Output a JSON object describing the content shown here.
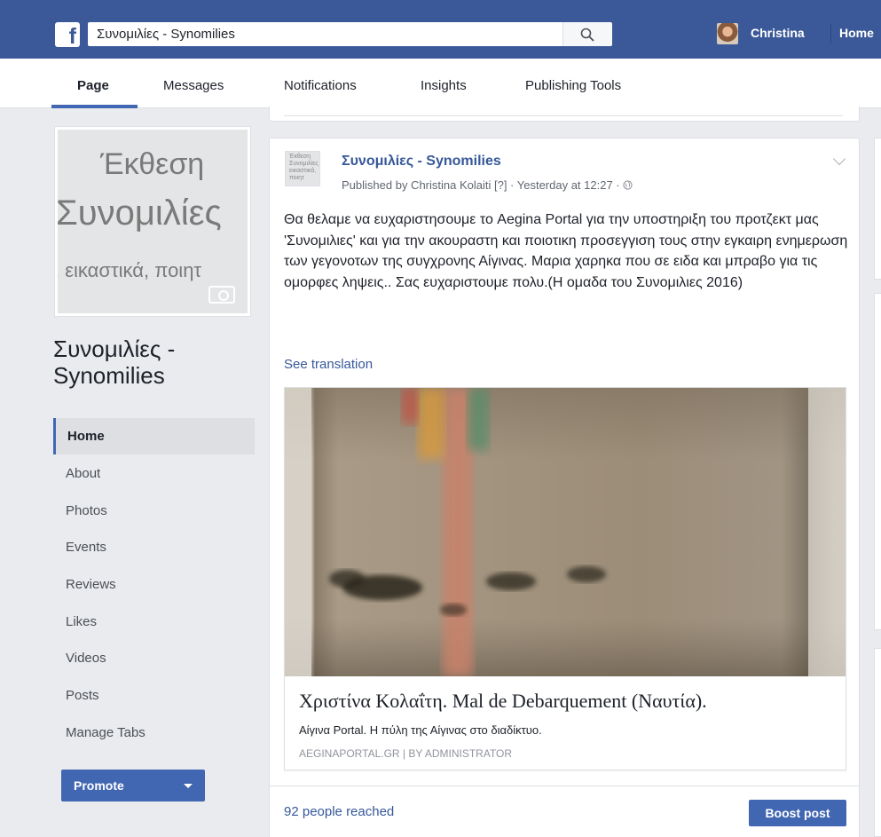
{
  "topbar": {
    "logo_letter": "f",
    "search_value": "Συνομιλίες - Synomilies",
    "user_name": "Christina",
    "home_label": "Home"
  },
  "page_tabs": [
    "Page",
    "Messages",
    "Notifications",
    "Insights",
    "Publishing Tools"
  ],
  "sidebar": {
    "cover_lines": [
      "Έκθεση",
      "Συνομιλίες",
      ", εικαστικά, ποιητ"
    ],
    "page_name": "Συνομιλίες - Synomilies",
    "nav": [
      "Home",
      "About",
      "Photos",
      "Events",
      "Reviews",
      "Likes",
      "Videos",
      "Posts",
      "Manage Tabs"
    ],
    "promote_label": "Promote"
  },
  "post": {
    "thumb_text": "Έκθεση Συνομιλίες εικαστικά, ποιητ",
    "author": "Συνομιλίες - Synomilies",
    "meta": "Published by Christina Kolaiti [?] · Yesterday at 12:27 ·",
    "text": "Θα θελαμε να ευχαριστησουμε το Aegina Portal για την υποστηριξη του προτζεκτ μας 'Συνομιλιες' και για την ακουραστη και ποιοτικη προσεγγιση τους στην εγκαιρη ενημερωση των γεγονοτων της συγχρονης Αίγινας. Μαρια χαρηκα που σε ειδα και μπραβο για τις ομορφες ληψεις.. Σας ευχαριστουμε πολυ.(Η ομαδα του Συνομιλιες 2016)",
    "see_translation": "See translation",
    "link": {
      "title": "Χριστίνα Κολαΐτη. Mal de Debarquement (Ναυτία).",
      "description": "Αίγινα Portal. Η πύλη της Αίγινας στο διαδίκτυο.",
      "source": "AEGINAPORTAL.GR | BY ADMINISTRATOR"
    },
    "reach": "92 people reached",
    "boost_label": "Boost post"
  },
  "colors": {
    "brand": "#3b5998",
    "accent": "#4267b2",
    "link": "#365899"
  }
}
